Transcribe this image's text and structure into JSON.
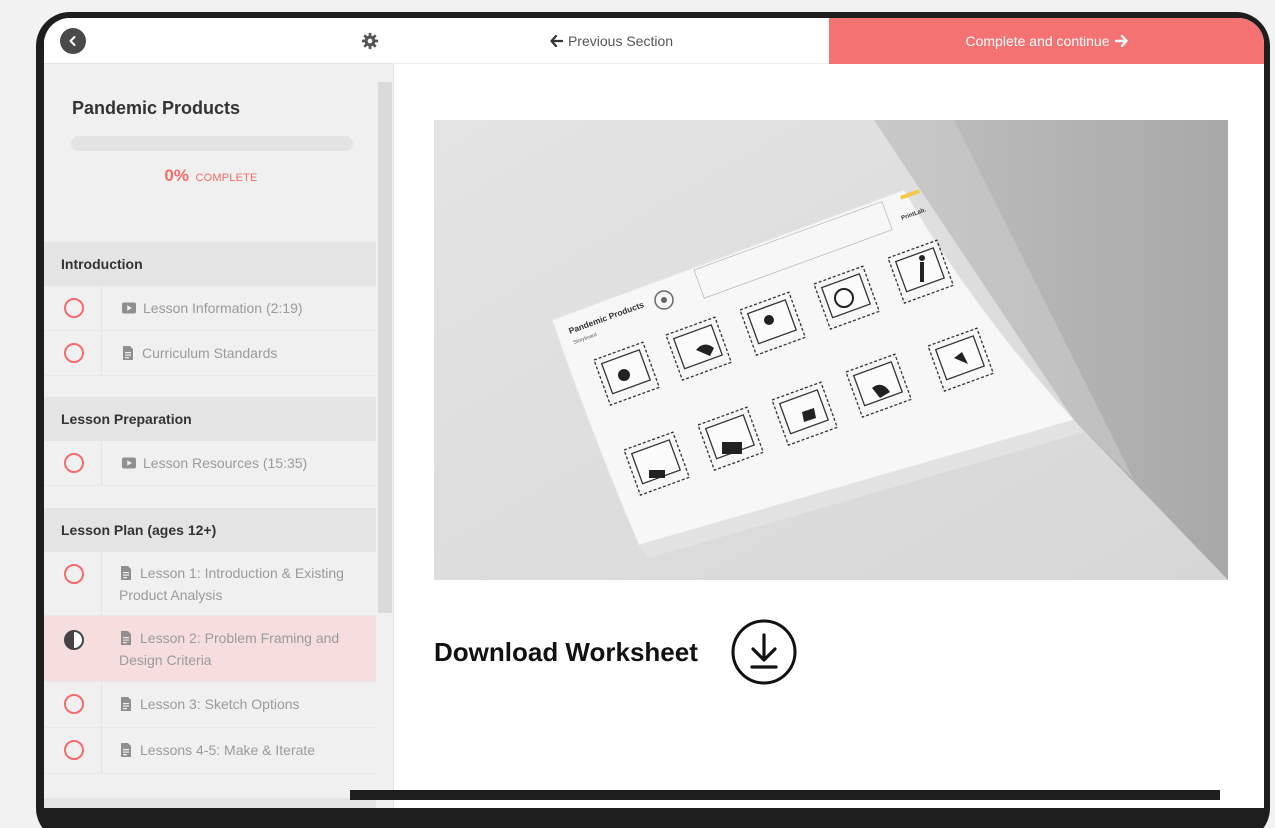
{
  "sidebar": {
    "course_title": "Pandemic Products",
    "progress": {
      "percent": 0,
      "percent_text": "0%",
      "label": "COMPLETE"
    },
    "sections": [
      {
        "title": "Introduction",
        "lessons": [
          {
            "icon": "video-icon",
            "label": "Lesson Information (2:19)",
            "status": "not-started"
          },
          {
            "icon": "document-icon",
            "label": "Curriculum Standards",
            "status": "not-started"
          }
        ]
      },
      {
        "title": "Lesson Preparation",
        "lessons": [
          {
            "icon": "video-icon",
            "label": "Lesson Resources (15:35)",
            "status": "not-started"
          }
        ]
      },
      {
        "title": "Lesson Plan (ages 12+)",
        "lessons": [
          {
            "icon": "document-icon",
            "label": "Lesson 1: Introduction & Existing Product Analysis",
            "status": "not-started"
          },
          {
            "icon": "document-icon",
            "label": "Lesson 2: Problem Framing and Design Criteria",
            "status": "in-progress"
          },
          {
            "icon": "document-icon",
            "label": "Lesson 3: Sketch Options",
            "status": "not-started"
          },
          {
            "icon": "document-icon",
            "label": "Lessons 4-5: Make & Iterate",
            "status": "not-started"
          }
        ]
      }
    ]
  },
  "topbar": {
    "previous_label": "Previous Section",
    "next_label": "Complete and continue"
  },
  "content": {
    "worksheet": {
      "title": "Pandemic Products",
      "subtitle": "Storyboard",
      "brand_top": "PrintLab."
    },
    "download_label": "Download Worksheet"
  },
  "colors": {
    "accent": "#f46c6c",
    "active_row": "#f6dede",
    "sidebar_bg": "#f0f0f0",
    "section_bg": "#e4e4e4"
  }
}
